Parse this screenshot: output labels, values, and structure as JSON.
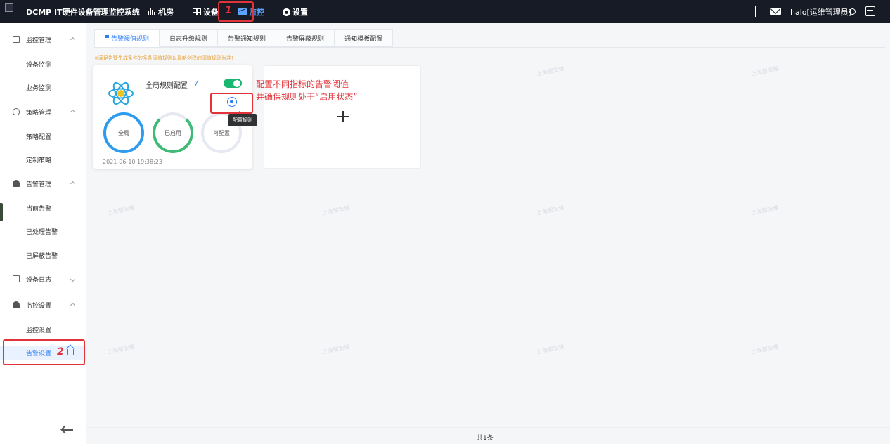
{
  "header": {
    "app_title": "DCMP IT硬件设备管理监控系统",
    "nav": [
      {
        "label": "机房",
        "icon": "bar-chart-icon",
        "active": false
      },
      {
        "label": "设备",
        "icon": "grid-icon",
        "active": false
      },
      {
        "label": "监控",
        "icon": "monitor-icon",
        "active": true
      },
      {
        "label": "设置",
        "icon": "gear-icon",
        "active": false
      }
    ],
    "user": "halo[运维管理员]",
    "accent_color": "#5aa3ff",
    "background_color": "#161b26"
  },
  "sidebar": {
    "groups": [
      {
        "label": "监控管理",
        "icon": "monitor-icon",
        "expanded": true,
        "items": [
          "设备监测",
          "业务监测"
        ]
      },
      {
        "label": "策略管理",
        "icon": "bulb-icon",
        "expanded": true,
        "items": [
          "策略配置",
          "定制策略"
        ]
      },
      {
        "label": "告警管理",
        "icon": "bell-icon",
        "expanded": true,
        "items": [
          "当前告警",
          "已处理告警",
          "已屏蔽告警"
        ]
      },
      {
        "label": "设备日志",
        "icon": "document-icon",
        "expanded": false,
        "items": []
      },
      {
        "label": "监控设置",
        "icon": "bell-icon",
        "expanded": true,
        "items": [
          "监控设置",
          "告警设置"
        ]
      }
    ],
    "active_item": "告警设置"
  },
  "tabs": [
    {
      "label": "告警阈值规则",
      "active": true
    },
    {
      "label": "日志升级规则",
      "active": false
    },
    {
      "label": "告警通知规则",
      "active": false
    },
    {
      "label": "告警屏蔽规则",
      "active": false
    },
    {
      "label": "通知模板配置",
      "active": false
    }
  ],
  "notice": "※满足告警生成条件的多条阈值规则以最新创建的阈值规则为准!",
  "rule_card": {
    "name": "全局规则配置",
    "enabled": true,
    "rings": [
      {
        "label": "全局",
        "color": "#2d9cf0"
      },
      {
        "label": "已启用",
        "color": "#3dbb77"
      },
      {
        "label": "可配置",
        "color": "#e6e8f2"
      }
    ],
    "timestamp": "2021-06-10 19:38:23",
    "tooltip": "配置规则"
  },
  "annotations": {
    "step1": "1",
    "step2": "2",
    "note_line1": "配置不同指标的告警阈值",
    "note_line2": "并确保规则处于“启用状态”",
    "color": "#e0343a"
  },
  "watermark": "上海智安维",
  "footer": {
    "total": "共1条"
  }
}
